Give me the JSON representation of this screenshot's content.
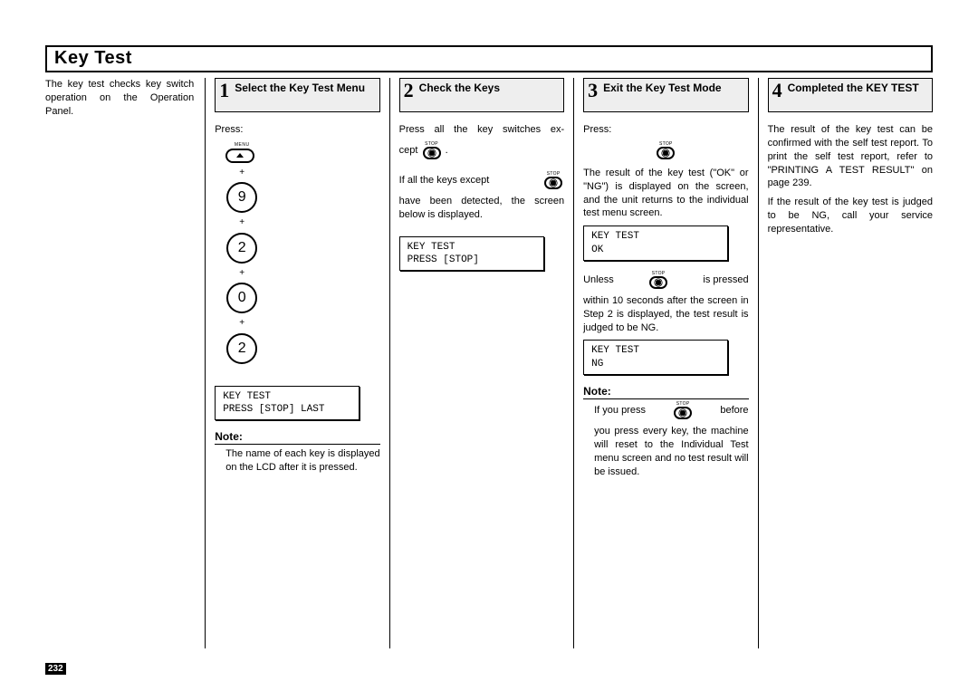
{
  "page_number": "232",
  "title": "Key Test",
  "intro": "The key test checks key switch operation on the Operation Panel.",
  "step1": {
    "num": "1",
    "title": "Select the Key Test Menu",
    "press_label": "Press:",
    "menu_label": "MENU",
    "keys": [
      "9",
      "2",
      "0",
      "2"
    ],
    "plus": "+",
    "lcd_line1": "KEY TEST",
    "lcd_line2": "PRESS [STOP] LAST",
    "note_head": "Note:",
    "note_body": "The name of each key is displayed on the LCD after it is pressed."
  },
  "step2": {
    "num": "2",
    "title": "Check the Keys",
    "line_a": "Press all the key switches ex-",
    "cept": "cept",
    "dot": ".",
    "stop_label": "STOP",
    "line_b_pre": "If all the keys except",
    "line_c": "have been detected, the screen below is displayed.",
    "lcd_line1": "KEY TEST",
    "lcd_line2": "PRESS [STOP]"
  },
  "step3": {
    "num": "3",
    "title": "Exit the Key Test Mode",
    "press_label": "Press:",
    "stop_label": "STOP",
    "para1": "The result of the key test (\"OK\" or \"NG\") is displayed on the screen, and the unit returns to the individual test menu screen.",
    "lcd_ok_1": "KEY TEST",
    "lcd_ok_2": "OK",
    "unless_pre": "Unless",
    "unless_post": "is   pressed",
    "para2": "within 10 seconds after the screen in Step 2 is displayed, the test result is judged to be NG.",
    "lcd_ng_1": "KEY TEST",
    "lcd_ng_2": "NG",
    "note_head": "Note:",
    "note_line_pre": "If you press",
    "note_line_post": "before",
    "note_body": "you press every key, the machine will reset to the Individual Test menu screen and no test result will be issued."
  },
  "step4": {
    "num": "4",
    "title": "Completed the KEY TEST",
    "para1": "The result of the key test can be confirmed with the self test report. To print the self test report, refer to \"PRINTING A TEST RESULT\" on page 239.",
    "para2": "If the result of the key test is judged to be NG, call your service representative."
  }
}
